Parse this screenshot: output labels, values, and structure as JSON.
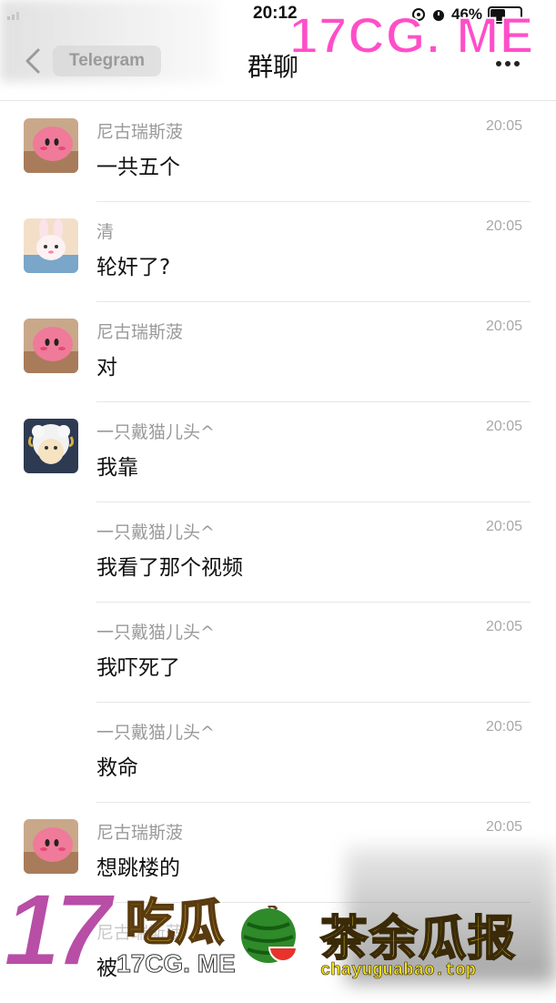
{
  "status_bar": {
    "time": "20:12",
    "battery": "46%",
    "battery_level": 0.46
  },
  "nav": {
    "back_label": "Telegram",
    "title": "群聊"
  },
  "watermarks": {
    "top": "17CG. ME",
    "bottom_number": "17",
    "bottom_chigua": "吃瓜",
    "bottom_domain": "17CG. ME",
    "chaye_title": "茶余瓜报",
    "chaye_url": "chayuguabao.top"
  },
  "messages": [
    {
      "sender": "尼古瑞斯菠",
      "time": "20:05",
      "text": "一共五个",
      "avatar": "pink-kirby-avatar"
    },
    {
      "sender": "清",
      "time": "20:05",
      "text": "轮奸了?",
      "avatar": "bunny-avatar"
    },
    {
      "sender": "尼古瑞斯菠",
      "time": "20:05",
      "text": "对",
      "avatar": "pink-kirby-avatar"
    },
    {
      "sender": "一只戴猫儿头^",
      "time": "20:05",
      "text": "我靠",
      "avatar": "sheep-avatar"
    },
    {
      "sender": "一只戴猫儿头^",
      "time": "20:05",
      "text": "我看了那个视频",
      "avatar": ""
    },
    {
      "sender": "一只戴猫儿头^",
      "time": "20:05",
      "text": "我吓死了",
      "avatar": ""
    },
    {
      "sender": "一只戴猫儿头^",
      "time": "20:05",
      "text": "救命",
      "avatar": ""
    },
    {
      "sender": "尼古瑞斯菠",
      "time": "20:05",
      "text": "想跳楼的",
      "avatar": "pink-kirby-avatar"
    },
    {
      "sender": "尼古瑞斯菠",
      "time": "",
      "text": "被",
      "avatar": ""
    }
  ],
  "colors": {
    "watermark_pink": "#ff4ec8",
    "watermark_purple": "#b84ea6",
    "watermark_yellow": "#f4e21a",
    "sender_gray": "#9a9a9a",
    "divider": "#e6e6e6"
  }
}
